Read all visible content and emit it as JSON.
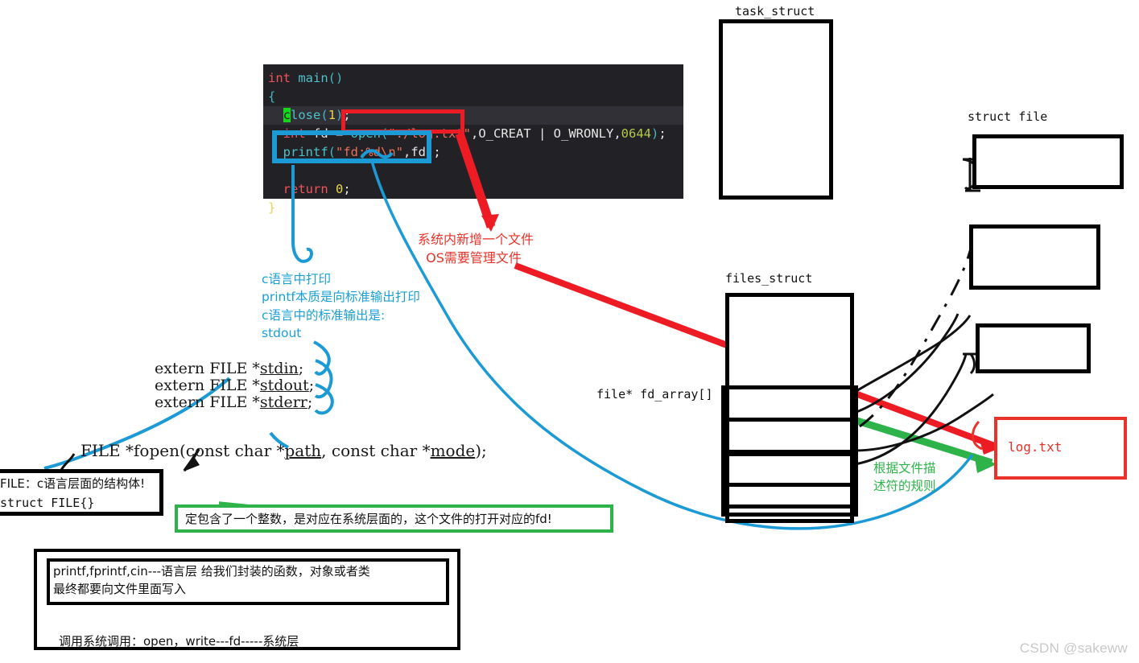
{
  "code": {
    "lines": [
      [
        {
          "t": "int",
          "c": "k-type"
        },
        {
          "t": " ",
          "c": "k-plain"
        },
        {
          "t": "main",
          "c": "k-fn"
        },
        {
          "t": "()",
          "c": "k-punc"
        }
      ],
      [
        {
          "t": "{",
          "c": "k-punc"
        }
      ],
      [
        {
          "t": "  ",
          "c": "k-plain"
        },
        {
          "t": "c",
          "c": "cursor"
        },
        {
          "t": "lose",
          "c": "k-fn"
        },
        {
          "t": "(",
          "c": "k-punc"
        },
        {
          "t": "1",
          "c": "k-num"
        },
        {
          "t": ")",
          "c": "k-punc"
        },
        {
          "t": ";",
          "c": "k-plain"
        }
      ],
      [
        {
          "t": "  ",
          "c": "k-plain"
        },
        {
          "t": "int",
          "c": "k-type"
        },
        {
          "t": " fd = ",
          "c": "k-plain"
        },
        {
          "t": "open",
          "c": "k-fn"
        },
        {
          "t": "(",
          "c": "k-punc"
        },
        {
          "t": "\"./log.txt\"",
          "c": "k-str"
        },
        {
          "t": ",",
          "c": "k-plain"
        },
        {
          "t": "O_CREAT | O_WRONLY,",
          "c": "k-plain"
        },
        {
          "t": "0644",
          "c": "k-num2"
        },
        {
          "t": ")",
          "c": "k-punc"
        },
        {
          "t": ";",
          "c": "k-plain"
        }
      ],
      [
        {
          "t": "  ",
          "c": "k-plain"
        },
        {
          "t": "printf",
          "c": "k-fn"
        },
        {
          "t": "(",
          "c": "k-punc"
        },
        {
          "t": "\"fd:%d\\n\"",
          "c": "k-str"
        },
        {
          "t": ",fd",
          "c": "k-plain"
        },
        {
          "t": ")",
          "c": "k-punc"
        },
        {
          "t": ";",
          "c": "k-plain"
        }
      ],
      [],
      [
        {
          "t": "  ",
          "c": "k-plain"
        },
        {
          "t": "return",
          "c": "k-type"
        },
        {
          "t": " ",
          "c": "k-plain"
        },
        {
          "t": "0",
          "c": "k-num"
        },
        {
          "t": ";",
          "c": "k-plain"
        }
      ],
      [
        {
          "t": "}",
          "c": "k-brace"
        }
      ]
    ],
    "highlight_line_index": 2,
    "red_highlight_target": "open(\"./log.txt\"",
    "blue_highlight_target": "printf(\"fd:%d\\n\",fd)"
  },
  "annotations": {
    "red_note": "系统内新增一个文件\n  OS需要管理文件",
    "blue_note": "c语言中打印\nprintf本质是向标准输出打印\nc语言中的标准输出是:\nstdout",
    "green_note": "根据文件描\n述符的规则"
  },
  "textbook": {
    "line1": "extern FILE *stdin;",
    "line1_plain": "extern FILE *",
    "line1_under": "stdin",
    "line2_plain": "extern FILE *",
    "line2_under": "stdout",
    "line3_plain": "extern FILE *",
    "line3_under": "stderr",
    "fopen_a": "FILE *fopen(const char *",
    "fopen_path": "path",
    "fopen_b": ", const char *",
    "fopen_mode": "mode",
    "fopen_c": ");"
  },
  "file_struct_box": {
    "line1": "FILE：c语言层面的结构体!",
    "line2": "struct FILE{}"
  },
  "green_box": {
    "text": "定包含了一个整数，是对应在系统层面的，这个文件的打开对应的fd!"
  },
  "bottom_box": {
    "line1": "printf,fprintf,cin---语言层 给我们封装的函数，对象或者类",
    "line2": "最终都要向文件里面写入",
    "line3": "调用系统调用：open，write---fd-----系统层"
  },
  "diagram": {
    "task_struct_label": "task_struct",
    "files_struct_label": "files_struct",
    "fd_array_label": "file* fd_array[]",
    "struct_file_label": "struct file",
    "logtxt_label": "log.txt"
  },
  "colors": {
    "red": "#e8322a",
    "blue": "#1a9fd4",
    "green": "#2db34a",
    "black": "#000000",
    "editor_bg": "#222226"
  },
  "watermark": "CSDN @sakeww"
}
